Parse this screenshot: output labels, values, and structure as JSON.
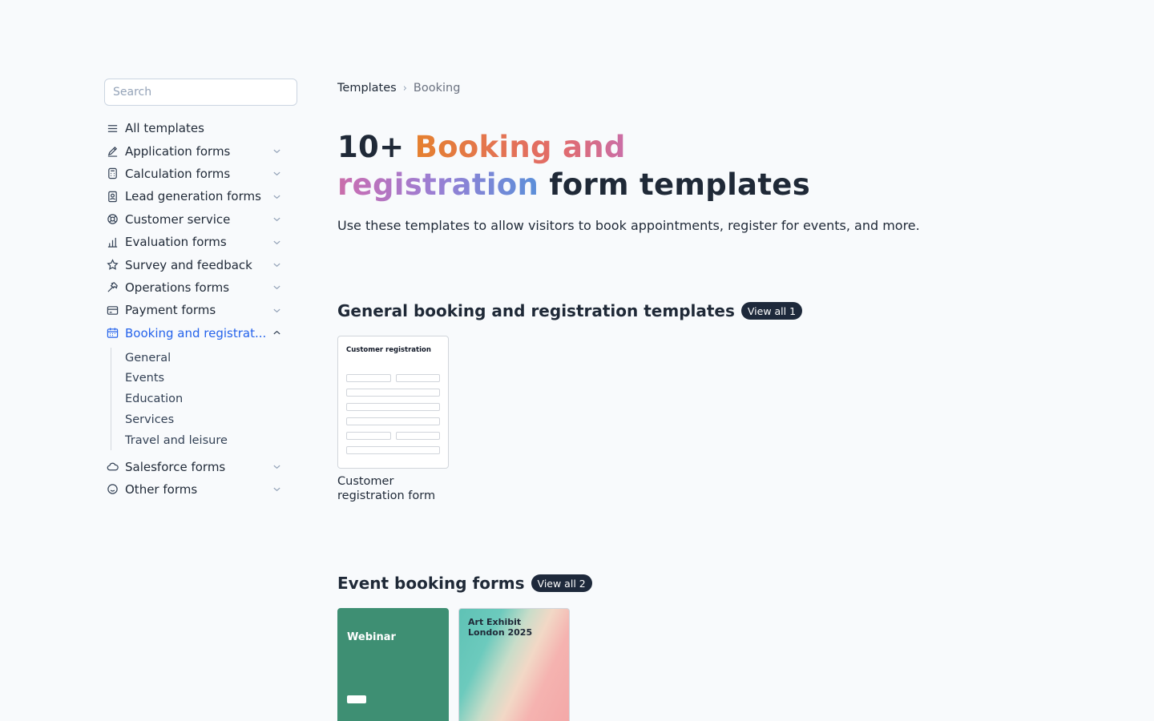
{
  "sidebar": {
    "search_placeholder": "Search",
    "items": [
      {
        "label": "All templates",
        "icon": "list-icon"
      },
      {
        "label": "Application forms",
        "icon": "pencil-icon"
      },
      {
        "label": "Calculation forms",
        "icon": "calculator-icon"
      },
      {
        "label": "Lead generation forms",
        "icon": "contact-icon"
      },
      {
        "label": "Customer service",
        "icon": "lifebuoy-icon"
      },
      {
        "label": "Evaluation forms",
        "icon": "bar-chart-icon"
      },
      {
        "label": "Survey and feedback",
        "icon": "star-icon"
      },
      {
        "label": "Operations forms",
        "icon": "hammer-icon"
      },
      {
        "label": "Payment forms",
        "icon": "credit-card-icon"
      },
      {
        "label": "Booking and registrat...",
        "icon": "calendar-icon"
      },
      {
        "label": "Salesforce forms",
        "icon": "cloud-icon"
      },
      {
        "label": "Other forms",
        "icon": "smiley-icon"
      }
    ],
    "sub_items": [
      "General",
      "Events",
      "Education",
      "Services",
      "Travel and leisure"
    ]
  },
  "breadcrumb": {
    "root": "Templates",
    "separator": "›",
    "current": "Booking"
  },
  "hero": {
    "prefix": "10+ ",
    "highlight": "Booking and registration",
    "suffix": " form templates",
    "subtitle": "Use these templates to allow visitors to book appointments, register for events, and more."
  },
  "sections": [
    {
      "title": "General booking and registration templates",
      "view_all": "View all 1",
      "cards": [
        {
          "title": "Customer registration form",
          "thumb_heading": "Customer registration"
        }
      ]
    },
    {
      "title": "Event booking forms",
      "view_all": "View all 2",
      "cards": [
        {
          "title": "",
          "thumb_heading": "Webinar"
        },
        {
          "title": "",
          "thumb_heading": "Art Exhibit London 2025"
        }
      ]
    }
  ],
  "colors": {
    "accent": "#2563eb",
    "badge_bg": "#1e293b",
    "webinar_bg": "#3e8f73"
  }
}
